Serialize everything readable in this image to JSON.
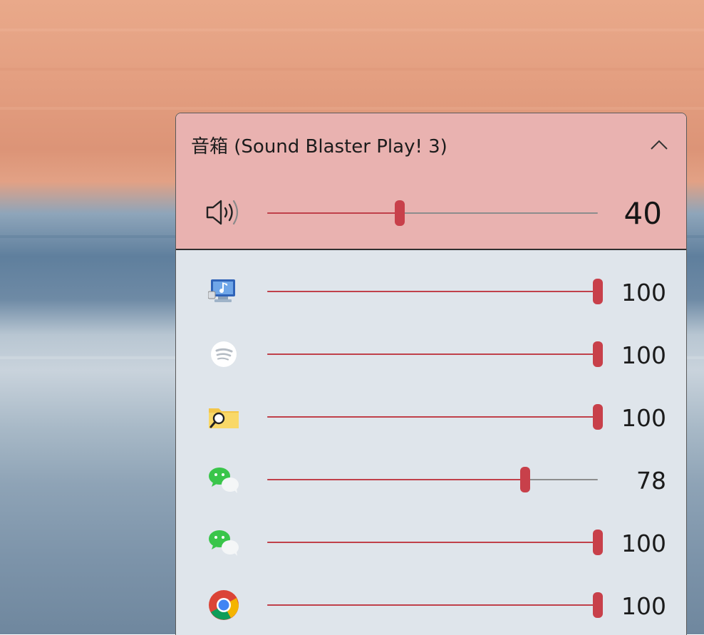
{
  "device": {
    "title": "音箱 (Sound Blaster Play! 3)",
    "volume": 40,
    "volume_label": "40",
    "speaker_icon": "speaker-volume-icon",
    "collapse_icon": "chevron-up-icon"
  },
  "apps": [
    {
      "name": "system-sounds",
      "icon": "system-sounds-icon",
      "volume": 100,
      "volume_label": "100"
    },
    {
      "name": "spotify",
      "icon": "spotify-icon",
      "volume": 100,
      "volume_label": "100"
    },
    {
      "name": "file-explorer-search",
      "icon": "folder-search-icon",
      "volume": 100,
      "volume_label": "100"
    },
    {
      "name": "wechat",
      "icon": "wechat-icon",
      "volume": 78,
      "volume_label": "78"
    },
    {
      "name": "wechat-2",
      "icon": "wechat-icon",
      "volume": 100,
      "volume_label": "100"
    },
    {
      "name": "chrome",
      "icon": "chrome-icon",
      "volume": 100,
      "volume_label": "100"
    }
  ],
  "colors": {
    "accent": "#c8404a",
    "device_background": "#e9b2b0",
    "panel_background": "#dfe5eb"
  }
}
